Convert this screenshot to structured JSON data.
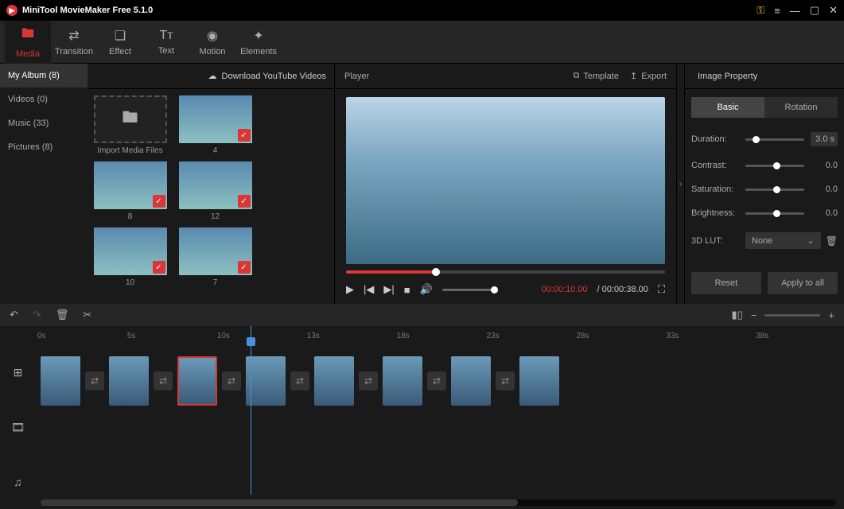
{
  "title": "MiniTool MovieMaker Free 5.1.0",
  "toolbar": [
    {
      "icon": "folder-icon",
      "glyph": "🖿",
      "label": "Media",
      "active": true
    },
    {
      "icon": "transition-icon",
      "glyph": "⇄",
      "label": "Transition"
    },
    {
      "icon": "effect-icon",
      "glyph": "❏",
      "label": "Effect"
    },
    {
      "icon": "text-icon",
      "glyph": "Tᴛ",
      "label": "Text"
    },
    {
      "icon": "motion-icon",
      "glyph": "◉",
      "label": "Motion"
    },
    {
      "icon": "elements-icon",
      "glyph": "✦",
      "label": "Elements"
    }
  ],
  "sidebar": [
    {
      "label": "My Album (8)",
      "active": true
    },
    {
      "label": "Videos (0)"
    },
    {
      "label": "Music (33)"
    },
    {
      "label": "Pictures (8)"
    }
  ],
  "media": {
    "download_label": "Download YouTube Videos",
    "import_label": "Import Media Files",
    "items": [
      {
        "label": "4"
      },
      {
        "label": "8"
      },
      {
        "label": "12"
      },
      {
        "label": "10"
      },
      {
        "label": "7"
      }
    ]
  },
  "player": {
    "title": "Player",
    "template_label": "Template",
    "export_label": "Export",
    "time_current": "00:00:10.00",
    "time_total": "/ 00:00:38.00"
  },
  "props": {
    "title": "Image Property",
    "tab_basic": "Basic",
    "tab_rotation": "Rotation",
    "duration_label": "Duration:",
    "duration_value": "3.0 s",
    "contrast_label": "Contrast:",
    "contrast_value": "0.0",
    "saturation_label": "Saturation:",
    "saturation_value": "0.0",
    "brightness_label": "Brightness:",
    "brightness_value": "0.0",
    "lut_label": "3D LUT:",
    "lut_value": "None",
    "reset_label": "Reset",
    "apply_label": "Apply to all"
  },
  "timeline": {
    "ticks": [
      "0s",
      "5s",
      "10s",
      "13s",
      "18s",
      "23s",
      "28s",
      "33s",
      "38s"
    ]
  }
}
